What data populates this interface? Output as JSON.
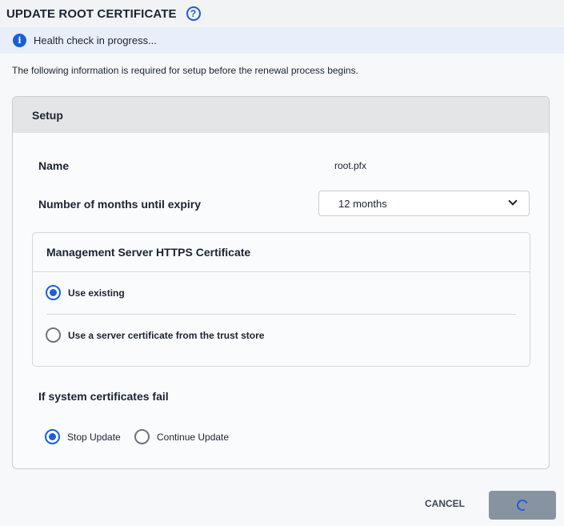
{
  "title": "UPDATE ROOT CERTIFICATE",
  "banner": "Health check in progress...",
  "intro": "The following information is required for setup before the renewal process begins.",
  "setup": {
    "header": "Setup",
    "name_label": "Name",
    "name_value": "root.pfx",
    "expiry_label": "Number of months until expiry",
    "expiry_value": "12 months",
    "https": {
      "header": "Management Server HTTPS Certificate",
      "options": [
        "Use existing",
        "Use a server certificate from the trust store"
      ],
      "selected": 0
    },
    "fail": {
      "label": "If system certificates fail",
      "options": [
        "Stop Update",
        "Continue Update"
      ],
      "selected": 0
    }
  },
  "buttons": {
    "cancel": "CANCEL"
  }
}
